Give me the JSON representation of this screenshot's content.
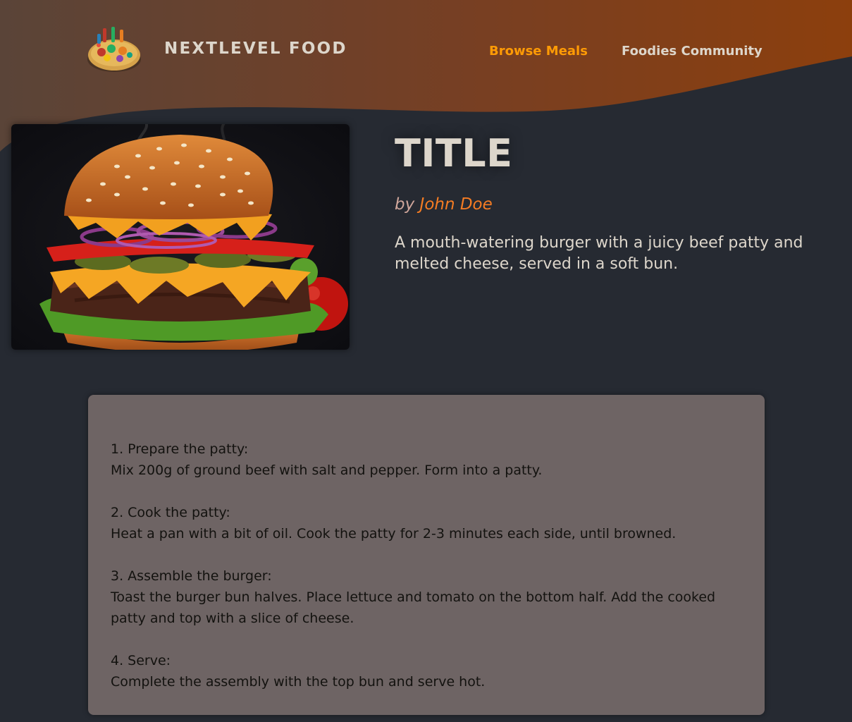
{
  "header": {
    "brand": "NEXTLEVEL FOOD",
    "nav": [
      {
        "label": "Browse Meals",
        "active": true
      },
      {
        "label": "Foodies Community",
        "active": false
      }
    ],
    "logo_icon": "food-plate-logo-icon"
  },
  "meal": {
    "title": "TITLE",
    "creator_prefix": "by ",
    "creator_name": "John Doe",
    "summary": "A mouth-watering burger with a juicy beef patty and melted cheese, served in a soft bun.",
    "image_alt": "burger"
  },
  "instructions": [
    {
      "heading": "1. Prepare the patty:",
      "text": "Mix 200g of ground beef with salt and pepper. Form into a patty."
    },
    {
      "heading": "2. Cook the patty:",
      "text": "Heat a pan with a bit of oil. Cook the patty for 2-3 minutes each side, until browned."
    },
    {
      "heading": "3. Assemble the burger:",
      "text": "Toast the burger bun halves. Place lettuce and tomato on the bottom half. Add the cooked patty and top with a slice of cheese."
    },
    {
      "heading": "4. Serve:",
      "text": "Complete the assembly with the top bun and serve hot."
    }
  ],
  "colors": {
    "background": "#262a32",
    "accent": "#ff9b05",
    "creator_link": "#f57c23",
    "header_gradient_start": "#5a4438",
    "header_gradient_end": "#8c3f0d",
    "instructions_bg": "#6e6464"
  }
}
